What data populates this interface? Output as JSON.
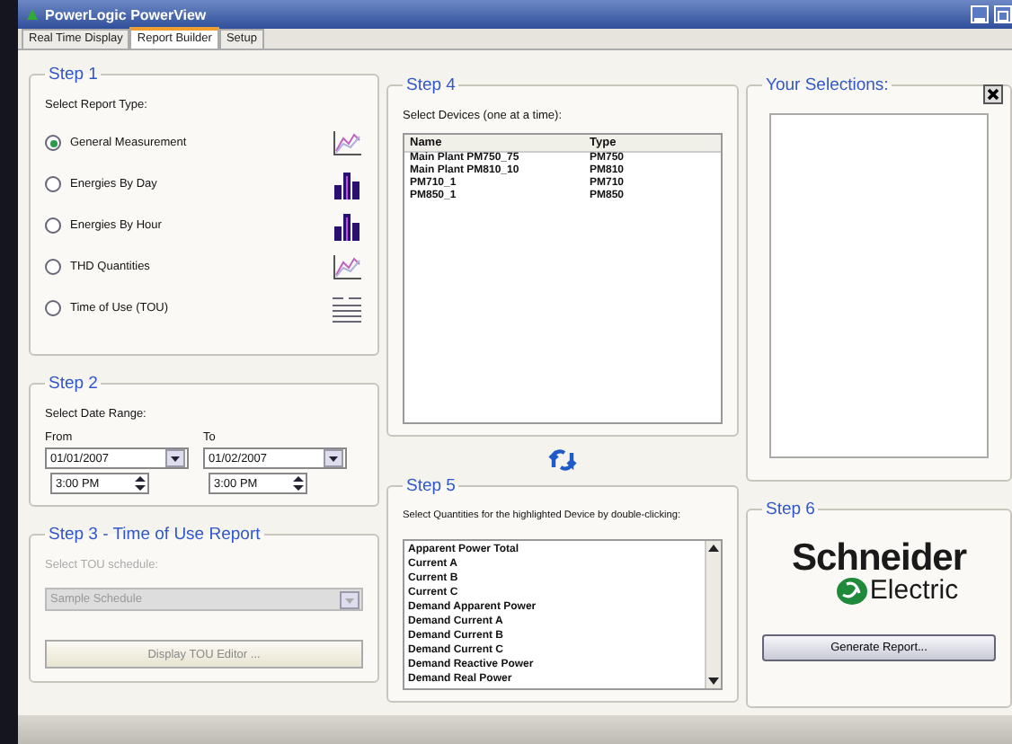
{
  "window": {
    "title": "PowerLogic PowerView"
  },
  "tabs": [
    {
      "label": "Real Time Display",
      "selected": false
    },
    {
      "label": "Report Builder",
      "selected": true
    },
    {
      "label": "Setup",
      "selected": false
    }
  ],
  "step1": {
    "title": "Step 1",
    "prompt": "Select Report Type:",
    "options": [
      {
        "label": "General Measurement",
        "selected": true,
        "kind": "line"
      },
      {
        "label": "Energies By Day",
        "selected": false,
        "kind": "bar"
      },
      {
        "label": "Energies By Hour",
        "selected": false,
        "kind": "bar"
      },
      {
        "label": "THD Quantities",
        "selected": false,
        "kind": "line"
      },
      {
        "label": "Time of Use (TOU)",
        "selected": false,
        "kind": "table"
      }
    ]
  },
  "step2": {
    "title": "Step 2",
    "prompt": "Select Date Range:",
    "from": {
      "label": "From",
      "date": "01/01/2007",
      "time": "3:00 PM"
    },
    "to": {
      "label": "To",
      "date": "01/02/2007",
      "time": "3:00 PM"
    }
  },
  "step3": {
    "title": "Step 3 - Time of Use Report",
    "prompt": "Select TOU schedule:",
    "schedule": "Sample Schedule",
    "button": "Display TOU Editor ...",
    "disabled": true
  },
  "step4": {
    "title": "Step 4",
    "prompt": "Select Devices (one at a time):",
    "columns": [
      "Name",
      "Type"
    ],
    "rows": [
      [
        "Main Plant PM750_75",
        "PM750"
      ],
      [
        "Main Plant PM810_10",
        "PM810"
      ],
      [
        "PM710_1",
        "PM710"
      ],
      [
        "PM850_1",
        "PM850"
      ]
    ]
  },
  "step5": {
    "title": "Step 5",
    "prompt": "Select Quantities for the highlighted Device by double-clicking:",
    "items": [
      "Apparent Power Total",
      "Current A",
      "Current B",
      "Current C",
      "Demand Apparent Power",
      "Demand Current A",
      "Demand Current B",
      "Demand Current C",
      "Demand Reactive Power",
      "Demand Real Power"
    ]
  },
  "selections": {
    "title": "Your Selections:"
  },
  "step6": {
    "title": "Step 6",
    "logo": {
      "line1": "Schneider",
      "line2": "Electric"
    },
    "button": "Generate Report..."
  }
}
